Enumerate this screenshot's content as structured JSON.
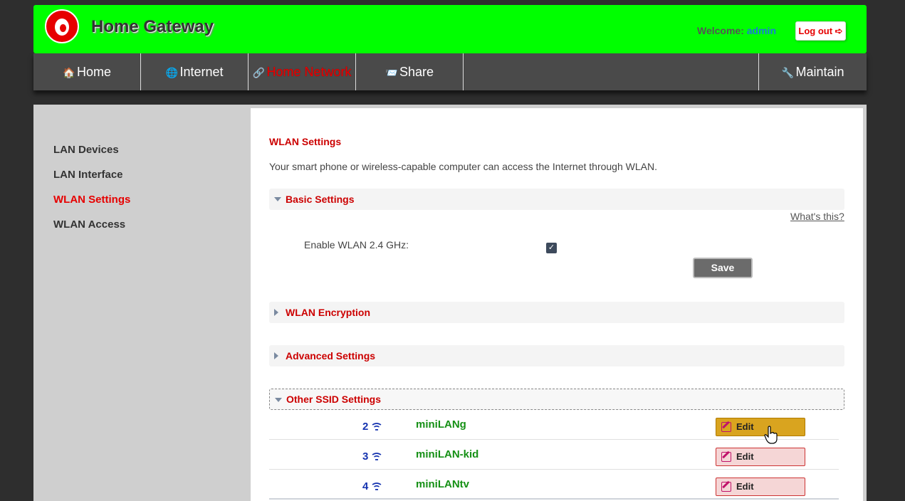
{
  "header": {
    "title": "Home Gateway",
    "welcome_label": "Welcome:",
    "username": "admin",
    "logout_label": "Log out ➪"
  },
  "nav": [
    {
      "icon": "house-icon",
      "label": "Home"
    },
    {
      "icon": "globe-icon",
      "label": "Internet"
    },
    {
      "icon": "link-icon",
      "label": "Home Network"
    },
    {
      "icon": "envelope-icon",
      "label": "Share"
    },
    {
      "icon": "wrench-icon",
      "label": "Maintain"
    }
  ],
  "sidebar": {
    "items": [
      {
        "label": "LAN Devices"
      },
      {
        "label": "LAN Interface"
      },
      {
        "label": "WLAN Settings"
      },
      {
        "label": "WLAN Access"
      }
    ]
  },
  "main": {
    "title": "WLAN Settings",
    "description": "Your smart phone or wireless-capable computer can access the Internet through WLAN.",
    "basic": {
      "label": "Basic Settings",
      "whats_this": "What's this?",
      "enable_label": "Enable WLAN 2.4 GHz:",
      "enabled": true,
      "save_label": "Save"
    },
    "encryption_label": "WLAN Encryption",
    "advanced_label": "Advanced Settings",
    "other_ssid": {
      "label": "Other SSID Settings",
      "rows": [
        {
          "index": "2",
          "ssid": "miniLANg",
          "edit_label": "Edit"
        },
        {
          "index": "3",
          "ssid": "miniLAN-kid",
          "edit_label": "Edit"
        },
        {
          "index": "4",
          "ssid": "miniLANtv",
          "edit_label": "Edit"
        }
      ]
    }
  },
  "colors": {
    "header_bg": "#00ff00",
    "brand_red": "#e60000",
    "nav_bg": "#4a4a4a",
    "ssid_green": "#159015",
    "index_blue": "#1533b0",
    "edit_hover": "#d9a41f"
  }
}
